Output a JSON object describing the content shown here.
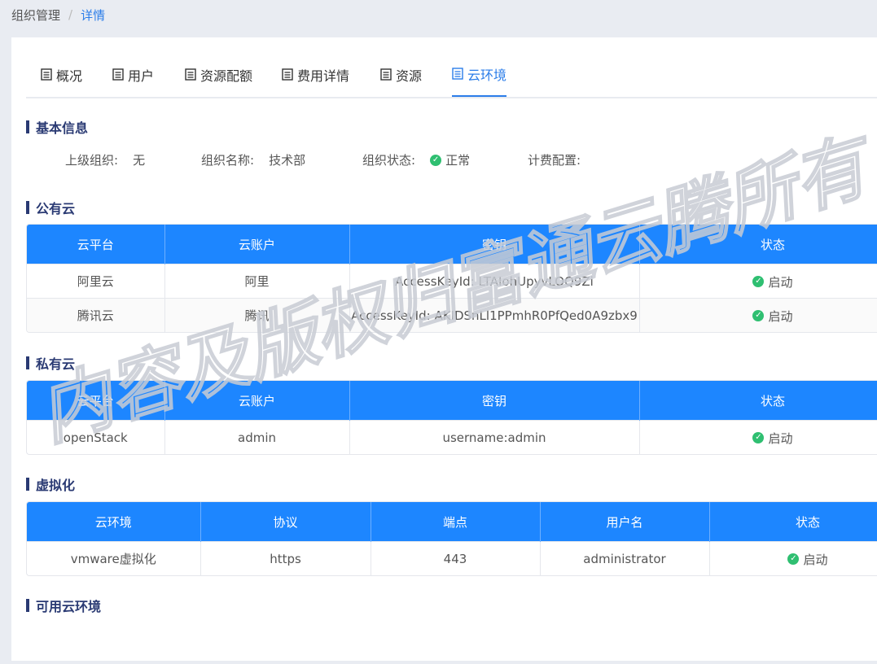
{
  "breadcrumb": {
    "parent": "组织管理",
    "separator": "/",
    "current": "详情"
  },
  "tabs": [
    {
      "label": "概况",
      "active": false
    },
    {
      "label": "用户",
      "active": false
    },
    {
      "label": "资源配额",
      "active": false
    },
    {
      "label": "费用详情",
      "active": false
    },
    {
      "label": "资源",
      "active": false
    },
    {
      "label": "云环境",
      "active": true
    }
  ],
  "basic_info": {
    "title": "基本信息",
    "parent_org_label": "上级组织:",
    "parent_org_value": "无",
    "org_name_label": "组织名称:",
    "org_name_value": "技术部",
    "org_status_label": "组织状态:",
    "org_status_value": "正常",
    "billing_label": "计费配置:"
  },
  "public_cloud": {
    "title": "公有云",
    "headers": [
      "云平台",
      "云账户",
      "密钥",
      "状态"
    ],
    "rows": [
      [
        "阿里云",
        "阿里",
        "AccessKeyId: LTAIohUpyvLOQ9Zi",
        "启动"
      ],
      [
        "腾讯云",
        "腾讯",
        "AccessKeyId: AKIDSnLl1PPmhR0PfQed0A9zbx9",
        "启动"
      ]
    ]
  },
  "private_cloud": {
    "title": "私有云",
    "headers": [
      "云平台",
      "云账户",
      "密钥",
      "状态"
    ],
    "rows": [
      [
        "openStack",
        "admin",
        "username:admin",
        "启动"
      ]
    ]
  },
  "virtualization": {
    "title": "虚拟化",
    "headers": [
      "云环境",
      "协议",
      "端点",
      "用户名",
      "状态"
    ],
    "rows": [
      [
        "vmware虚拟化",
        "https",
        "443",
        "administrator",
        "启动"
      ]
    ]
  },
  "available_cloud": {
    "title": "可用云环境"
  },
  "watermark": {
    "text": "内容及版权归富通云腾所有",
    "color": "#c8ccd4"
  },
  "colors": {
    "accent": "#1d86ff",
    "active_tab": "#2b7de9",
    "section_title": "#2a3a73",
    "status_ok": "#2fbf71"
  },
  "icons": {
    "tab_icon": "document-list-icon",
    "status_icon": "check-circle-icon"
  }
}
